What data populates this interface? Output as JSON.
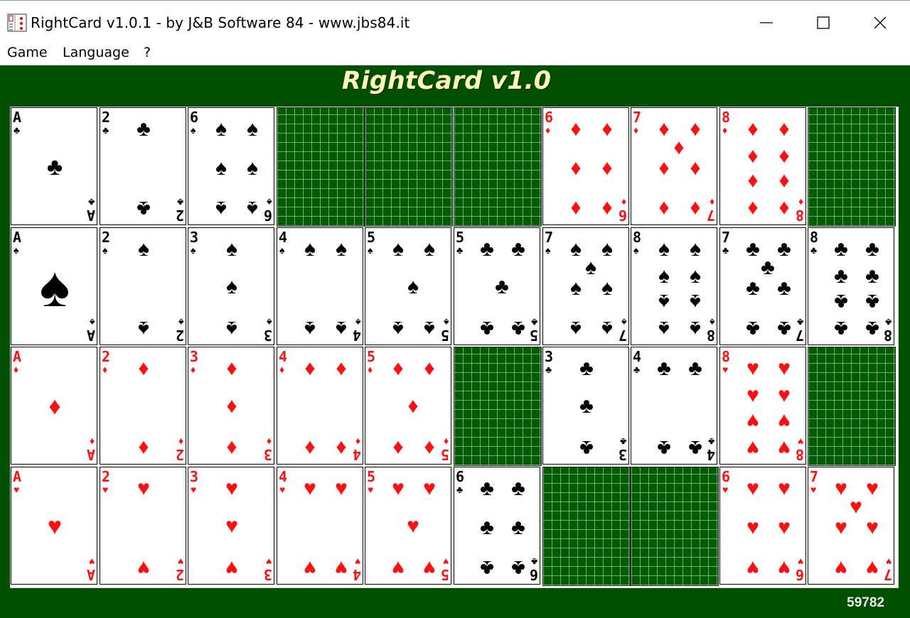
{
  "window": {
    "title": "RightCard v1.0.1 -  by J&B Software 84 - www.jbs84.it",
    "controls": [
      "minimize",
      "maximize",
      "close"
    ]
  },
  "menu": {
    "items": [
      "Game",
      "Language",
      "?"
    ]
  },
  "game": {
    "title": "RightCard v1.0",
    "score": "59782",
    "colors": {
      "felt": "#004f00",
      "slot": "#006000",
      "red": "#ff1010",
      "black": "#000000",
      "title": "#fafab4"
    },
    "rows": [
      [
        {
          "rank": "A",
          "suit": "clubs"
        },
        {
          "rank": "2",
          "suit": "clubs"
        },
        {
          "rank": "6",
          "suit": "spades"
        },
        null,
        null,
        null,
        {
          "rank": "6",
          "suit": "diamonds"
        },
        {
          "rank": "7",
          "suit": "diamonds"
        },
        {
          "rank": "8",
          "suit": "diamonds"
        },
        null
      ],
      [
        {
          "rank": "A",
          "suit": "spades"
        },
        {
          "rank": "2",
          "suit": "spades"
        },
        {
          "rank": "3",
          "suit": "spades"
        },
        {
          "rank": "4",
          "suit": "spades"
        },
        {
          "rank": "5",
          "suit": "spades"
        },
        {
          "rank": "5",
          "suit": "clubs"
        },
        {
          "rank": "7",
          "suit": "spades"
        },
        {
          "rank": "8",
          "suit": "spades"
        },
        {
          "rank": "7",
          "suit": "clubs"
        },
        {
          "rank": "8",
          "suit": "clubs"
        }
      ],
      [
        {
          "rank": "A",
          "suit": "diamonds"
        },
        {
          "rank": "2",
          "suit": "diamonds"
        },
        {
          "rank": "3",
          "suit": "diamonds"
        },
        {
          "rank": "4",
          "suit": "diamonds"
        },
        {
          "rank": "5",
          "suit": "diamonds"
        },
        null,
        {
          "rank": "3",
          "suit": "clubs"
        },
        {
          "rank": "4",
          "suit": "clubs"
        },
        {
          "rank": "8",
          "suit": "hearts"
        },
        null
      ],
      [
        {
          "rank": "A",
          "suit": "hearts"
        },
        {
          "rank": "2",
          "suit": "hearts"
        },
        {
          "rank": "3",
          "suit": "hearts"
        },
        {
          "rank": "4",
          "suit": "hearts"
        },
        {
          "rank": "5",
          "suit": "hearts"
        },
        {
          "rank": "6",
          "suit": "clubs"
        },
        null,
        null,
        {
          "rank": "6",
          "suit": "hearts"
        },
        {
          "rank": "7",
          "suit": "hearts"
        }
      ]
    ]
  }
}
